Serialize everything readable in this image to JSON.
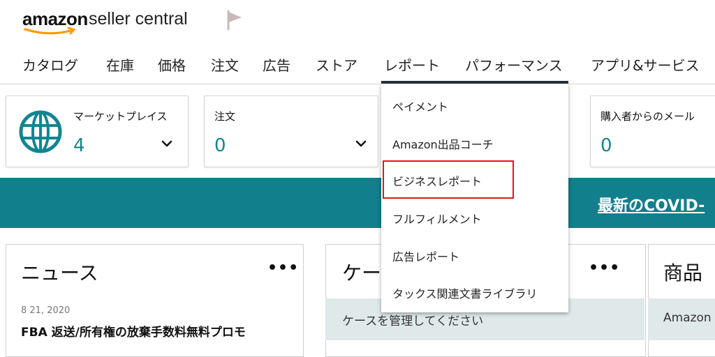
{
  "header": {
    "logo_amazon": "amazon",
    "logo_seller_central": "seller central"
  },
  "nav": {
    "items": [
      "カタログ",
      "在庫",
      "価格",
      "注文",
      "広告",
      "ストア",
      "レポート",
      "パフォーマンス",
      "アプリ&サービス"
    ],
    "active": "レポート"
  },
  "cards": {
    "marketplace": {
      "label": "マーケットプレイス",
      "value": "4"
    },
    "orders": {
      "label": "注文",
      "value": "0"
    },
    "buyer_messages": {
      "label": "購入者からのメール",
      "value": "0"
    }
  },
  "banner": {
    "link_text": "最新のCOVID-"
  },
  "panels": {
    "news": {
      "title": "ニュース",
      "date": "8 21, 2020",
      "headline": "FBA 返送/所有権の放棄手数料無料プロモ"
    },
    "cases": {
      "title": "ケー",
      "subtitle": "ケースを管理してください"
    },
    "products": {
      "title": "商品",
      "subtitle": "Amazon"
    }
  },
  "dropdown": {
    "items": [
      "ペイメント",
      "Amazon出品コーチ",
      "ビジネスレポート",
      "フルフィルメント",
      "広告レポート",
      "タックス関連文書ライブラリ"
    ],
    "highlighted": "ビジネスレポート"
  },
  "colors": {
    "accent_teal": "#117f8c",
    "value_teal": "#128591",
    "highlight_red": "#e3131b",
    "nav_underline": "#232f3e",
    "amazon_orange": "#ff9900"
  }
}
